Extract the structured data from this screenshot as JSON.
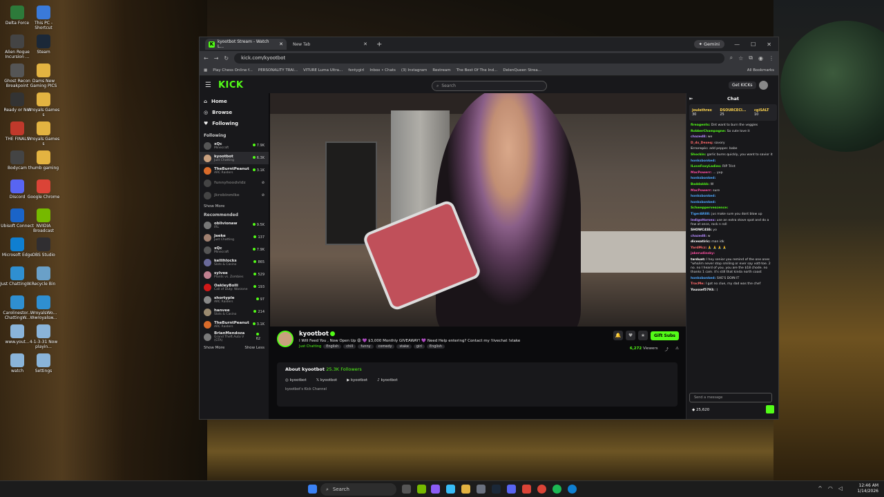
{
  "desktop_icons": [
    {
      "label": "Delta Force",
      "color": "#2d7a3a"
    },
    {
      "label": "This PC - Shortcut",
      "color": "#3a7ad9"
    },
    {
      "label": "Alien Rogue Incursion ...",
      "color": "#444"
    },
    {
      "label": "Steam",
      "color": "#1b2838"
    },
    {
      "label": "Ghost Recon Breakpoint",
      "color": "#555"
    },
    {
      "label": "Dams New Gaming PICS",
      "color": "#e3b341"
    },
    {
      "label": "Ready or Not",
      "color": "#333"
    },
    {
      "label": "Wroyals Games s",
      "color": "#e3b341"
    },
    {
      "label": "THE FINALS",
      "color": "#c0392b"
    },
    {
      "label": "Wroyals Games s",
      "color": "#e3b341"
    },
    {
      "label": "Bodycam",
      "color": "#444"
    },
    {
      "label": "thumb gaming",
      "color": "#e3b341"
    },
    {
      "label": "Discord",
      "color": "#5865f2"
    },
    {
      "label": "Google Chrome",
      "color": "#db4437"
    },
    {
      "label": "Ubisoft Connect",
      "color": "#1a64c8"
    },
    {
      "label": "NVIDIA Broadcast",
      "color": "#76b900"
    },
    {
      "label": "Microsoft Edge",
      "color": "#0f7fd1"
    },
    {
      "label": "OBS Studio",
      "color": "#302e31"
    },
    {
      "label": "Just ChattingW...",
      "color": "#2f8fd1"
    },
    {
      "label": "Recycle Bin",
      "color": "#6aa0c8"
    },
    {
      "label": "Carolinestor... ChattingW...",
      "color": "#2f8fd1"
    },
    {
      "label": "WroyalsWo... Wwroyalsw...",
      "color": "#2f8fd1"
    },
    {
      "label": "www.yout...",
      "color": "#8ab4d9"
    },
    {
      "label": "4-1-3-31 Now playin...",
      "color": "#8ab4d9"
    },
    {
      "label": "watch",
      "color": "#8ab4d9"
    },
    {
      "label": "Settings",
      "color": "#8ab4d9"
    }
  ],
  "browser": {
    "tabs": [
      {
        "title": "kyootbot Stream - Watch L...",
        "active": true
      },
      {
        "title": "New Tab",
        "active": false
      }
    ],
    "gemini_label": "Gemini",
    "url": "kick.com/kyootbot",
    "bookmarks": [
      "Play Chess Online f...",
      "PERSONALITY TRAI...",
      "VITURE Luma Ultra...",
      "fentygirl",
      "Inbox • Chats",
      "(3) Instagram",
      "Restream",
      "The Best Of The Ind...",
      "DelenQueen Strea..."
    ],
    "all_bookmarks": "All Bookmarks"
  },
  "kick": {
    "logo": "KICK",
    "search_placeholder": "Search",
    "get_kicks": "Get KICKs",
    "nav": [
      {
        "label": "Home",
        "icon": "home-icon"
      },
      {
        "label": "Browse",
        "icon": "compass-icon"
      },
      {
        "label": "Following",
        "icon": "heart-icon"
      }
    ],
    "following_header": "Following",
    "following": [
      {
        "name": "xQc",
        "category": "Minecraft",
        "viewers": "7.9K",
        "color": "#555",
        "online": true
      },
      {
        "name": "kyootbot",
        "category": "Just Chatting",
        "viewers": "6.3K",
        "color": "#c9a07e",
        "online": true,
        "selected": true
      },
      {
        "name": "TheBurntPeanut",
        "category": "ARC Raiders",
        "viewers": "3.1K",
        "color": "#d96b2a",
        "online": true
      },
      {
        "name": "funnyhoodvidz",
        "category": "",
        "viewers": "",
        "color": "#444",
        "online": false
      },
      {
        "name": "jkrobinmike",
        "category": "",
        "viewers": "",
        "color": "#444",
        "online": false
      }
    ],
    "show_more_1": "Show More",
    "recommended_header": "Recommended",
    "recommended": [
      {
        "name": "oblivionaw",
        "category": "IRL",
        "viewers": "9.5K",
        "color": "#777"
      },
      {
        "name": "Jaeke",
        "category": "Just Chatting",
        "viewers": "137",
        "color": "#a08070"
      },
      {
        "name": "xQc",
        "category": "Minecraft",
        "viewers": "7.9K",
        "color": "#555"
      },
      {
        "name": "kellihlocks",
        "category": "Slots & Casino",
        "viewers": "865",
        "color": "#6a6a9a"
      },
      {
        "name": "sylvee",
        "category": "Plants vs. Zombies",
        "viewers": "529",
        "color": "#c08090"
      },
      {
        "name": "OakleyBolli",
        "category": "Call of Duty: Warzone",
        "viewers": "193",
        "color": "#d01818"
      },
      {
        "name": "shortyple",
        "category": "ARC Raiders",
        "viewers": "97",
        "color": "#888"
      },
      {
        "name": "hanvee",
        "category": "Slots & Casino",
        "viewers": "214",
        "color": "#9a8a70"
      },
      {
        "name": "TheBurntPeanut",
        "category": "ARC Raiders",
        "viewers": "3.1K",
        "color": "#d96b2a"
      },
      {
        "name": "BrianMendoza",
        "category": "Grand Theft Auto V (GTA)",
        "viewers": "62",
        "color": "#7a7a7a"
      }
    ],
    "show_more_2": "Show More",
    "show_less": "Show Less",
    "stream": {
      "channel": "kyootbot",
      "title": "I Will Feed You , Now Open Up 😩 💜 $3,000 Monthly GIVEAWAY! 💜 Need Help entering? Contact my !livechat !stake",
      "category": "Just Chatting",
      "tags": [
        "English",
        "chill",
        "funny",
        "comedy",
        "stake",
        "girl",
        "English"
      ],
      "gift_subs": "Gift Subs",
      "viewers": "6,272",
      "viewers_label": "Viewers",
      "about_title": "About kyootbot",
      "followers": "25.3K",
      "followers_label": "Followers",
      "socials": [
        {
          "icon": "instagram-icon",
          "label": "kyootbot"
        },
        {
          "icon": "x-icon",
          "label": "kyootbot"
        },
        {
          "icon": "youtube-icon",
          "label": "kyootbot"
        },
        {
          "icon": "tiktok-icon",
          "label": "kyootbot"
        }
      ],
      "description": "kyootbot's Kick Channel"
    },
    "chat": {
      "title": "Chat",
      "pinned": [
        {
          "user": "joulethrex",
          "count": "30"
        },
        {
          "user": "DSOURCECI...",
          "count": "25"
        },
        {
          "user": "cgiSALT",
          "count": "10"
        }
      ],
      "messages": [
        {
          "user": "fireagents:",
          "color": "#53fc18",
          "text": "Dnt want to burn the veggies"
        },
        {
          "user": "RobberChampagne:",
          "color": "#53fc18",
          "text": "So cute love it"
        },
        {
          "user": "chazed8:",
          "color": "#b58bff",
          "text": "we"
        },
        {
          "user": "D_dx_Dexeq:",
          "color": "#ff6b6b",
          "text": "savory"
        },
        {
          "user": "Errorepic:",
          "color": "#aaa",
          "text": "add pepper. babe"
        },
        {
          "user": "Shockin:",
          "color": "#53fc18",
          "text": "garlic burns quickly, you want to savior it"
        },
        {
          "user": "honksbonked:",
          "color": "#4fa8ff",
          "text": ""
        },
        {
          "user": "ILoveFoxyLadies:",
          "color": "#53fc18",
          "text": "RIP Trint"
        },
        {
          "user": "MacPowerr:",
          "color": "#ff4fa3",
          "text": "... yup"
        },
        {
          "user": "honksbonked:",
          "color": "#4fa8ff",
          "text": ""
        },
        {
          "user": "Baddakkk:",
          "color": "#53fc18",
          "text": "W"
        },
        {
          "user": "MacPowerr:",
          "color": "#ff4fa3",
          "text": "sure"
        },
        {
          "user": "honksbonked:",
          "color": "#4fa8ff",
          "text": ""
        },
        {
          "user": "honksbonked:",
          "color": "#4fa8ff",
          "text": ""
        },
        {
          "user": "Schweppervescence:",
          "color": "#53fc18",
          "text": ""
        },
        {
          "user": "TigerAR88:",
          "color": "#4fa8ff",
          "text": "jus make sure you dont blow up"
        },
        {
          "user": "IndigoHorsex:",
          "color": "#b58bff",
          "text": "use an extra stove spot and do a few at once, rock n roll"
        },
        {
          "user": "SHOWC4SS:",
          "color": "#fff",
          "text": "yo"
        },
        {
          "user": "chazed8:",
          "color": "#b58bff",
          "text": "w"
        },
        {
          "user": "dicesatiric:",
          "color": "#fff",
          "text": "man idk"
        },
        {
          "user": "YardMcz:",
          "color": "#ff6b6b",
          "text": "🙏 🙏 🙏 🙏"
        },
        {
          "user": "jakerudinsky:",
          "color": "#ff4fa3",
          "text": ""
        },
        {
          "user": "tarduat:",
          "color": "#fff",
          "text": "I hey senior you remind of the one ones \"who/im never stop smiling or ever say vott-toe. 2 no. no I heard of you. you are the $18 chode. no thanks 1 cam. it's still that kinda north coast"
        },
        {
          "user": "honksbonked:",
          "color": "#4fa8ff",
          "text": "SHE'S DOIN IT"
        },
        {
          "user": "TracMe:",
          "color": "#ff6b6b",
          "text": "I got no clue, my dad was the chef"
        },
        {
          "user": "Youssef5793:",
          "color": "#fff",
          "text": ":)"
        }
      ],
      "input_placeholder": "Send a message",
      "points": "25,620"
    }
  },
  "taskbar": {
    "search_placeholder": "Search",
    "time": "12:46 AM",
    "date": "1/14/2026"
  }
}
